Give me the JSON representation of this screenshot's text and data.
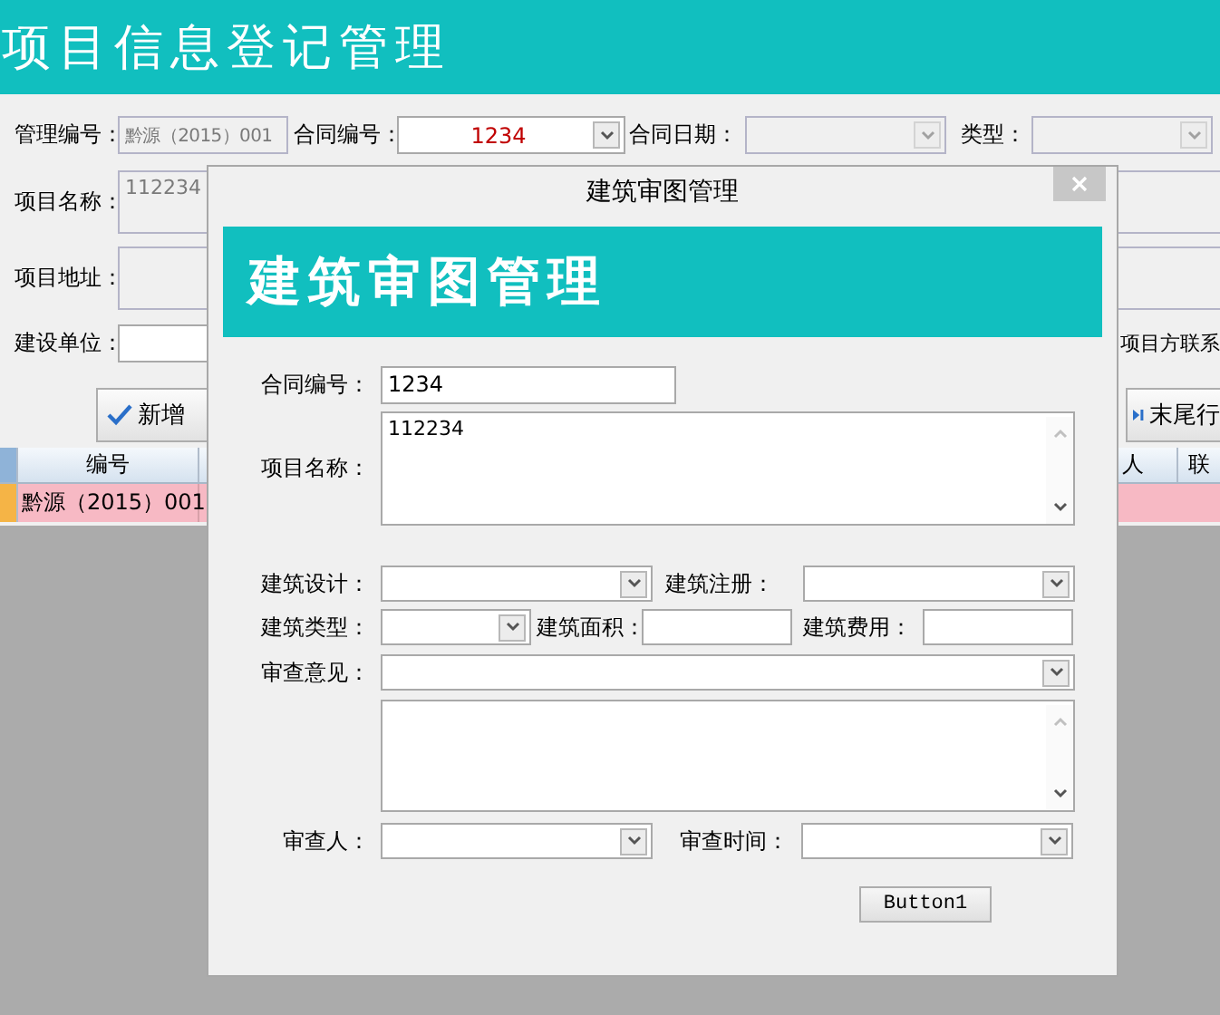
{
  "header": {
    "title": "项目信息登记管理"
  },
  "form": {
    "management_no": {
      "label": "管理编号：",
      "value": "黔源（2015）001",
      "disabled": true
    },
    "contract_no": {
      "label": "合同编号：",
      "value": "1234",
      "disabled": false
    },
    "contract_date": {
      "label": "合同日期：",
      "disabled": true
    },
    "type": {
      "label": "类型：",
      "disabled": true
    },
    "project_name": {
      "label": "项目名称：",
      "value": "112234"
    },
    "project_address": {
      "label": "项目地址："
    },
    "builder": {
      "label": "建设单位："
    },
    "contact_label": "项目方联系"
  },
  "toolbar": {
    "buttons": [
      {
        "label": "新增",
        "kind": "add"
      },
      {
        "label": "末尾行",
        "kind": "last"
      }
    ]
  },
  "grid": {
    "columns": [
      {
        "label": "编号"
      },
      {
        "label": "人"
      },
      {
        "label": "联"
      }
    ],
    "rows": [
      {
        "cells": [
          "黔源（2015）001"
        ],
        "selected": true
      }
    ]
  },
  "dialog": {
    "title": "建筑审图管理",
    "banner": "建筑审图管理",
    "contract_no": {
      "label": "合同编号：",
      "value": "1234"
    },
    "project_name": {
      "label": "项目名称：",
      "value": "112234"
    },
    "design": {
      "label": "建筑设计："
    },
    "registration": {
      "label": "建筑注册："
    },
    "building_type": {
      "label": "建筑类型："
    },
    "area": {
      "label": "建筑面积："
    },
    "cost": {
      "label": "建筑费用："
    },
    "opinion": {
      "label": "审查意见："
    },
    "reviewer": {
      "label": "审查人："
    },
    "review_time": {
      "label": "审查时间："
    },
    "button": "Button1"
  }
}
